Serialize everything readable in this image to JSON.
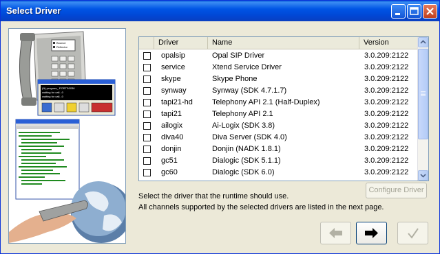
{
  "window": {
    "title": "Select Driver"
  },
  "table": {
    "columns": {
      "driver": "Driver",
      "name": "Name",
      "version": "Version"
    },
    "rows": [
      {
        "driver": "opalsip",
        "name": "Opal SIP Driver",
        "version": "3.0.209:2122",
        "checked": false
      },
      {
        "driver": "service",
        "name": "Xtend Service Driver",
        "version": "3.0.209:2122",
        "checked": false
      },
      {
        "driver": "skype",
        "name": "Skype Phone",
        "version": "3.0.209:2122",
        "checked": false
      },
      {
        "driver": "synway",
        "name": "Synway (SDK 4.7.1.7)",
        "version": "3.0.209:2122",
        "checked": false
      },
      {
        "driver": "tapi21-hd",
        "name": "Telephony API 2.1 (Half-Duplex)",
        "version": "3.0.209:2122",
        "checked": false
      },
      {
        "driver": "tapi21",
        "name": "Telephony API 2.1",
        "version": "3.0.209:2122",
        "checked": false
      },
      {
        "driver": "ailogix",
        "name": "Ai-Logix (SDK 3.8)",
        "version": "3.0.209:2122",
        "checked": false
      },
      {
        "driver": "diva40",
        "name": "Diva Server (SDK 4.0)",
        "version": "3.0.209:2122",
        "checked": false
      },
      {
        "driver": "donjin",
        "name": "Donjin (NADK 1.8.1)",
        "version": "3.0.209:2122",
        "checked": false
      },
      {
        "driver": "gc51",
        "name": "Dialogic (SDK 5.1.1)",
        "version": "3.0.209:2122",
        "checked": false
      },
      {
        "driver": "gc60",
        "name": "Dialogic (SDK 6.0)",
        "version": "3.0.209:2122",
        "checked": false
      }
    ]
  },
  "buttons": {
    "configure": "Configure Driver"
  },
  "description": {
    "line1": "Select the driver that the runtime should use.",
    "line2": "All channels supported by the selected drivers are listed in the next page."
  },
  "illustration": {
    "phone_labels": [
      "Bounce",
      "Reflector"
    ],
    "dialog_lines": [
      "(N) program_ PORTS0036",
      "waiting for call...0",
      "waiting for call...0"
    ]
  },
  "colors": {
    "titlebar": "#0055e5",
    "face": "#ece9d8",
    "border": "#7f9db9"
  }
}
